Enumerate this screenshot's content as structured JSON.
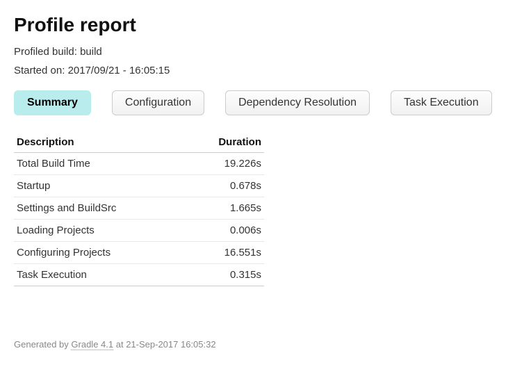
{
  "title": "Profile report",
  "profiled_build_label": "Profiled build:",
  "profiled_build_value": "build",
  "started_on_label": "Started on:",
  "started_on_value": "2017/09/21 - 16:05:15",
  "tabs": [
    {
      "label": "Summary",
      "active": true
    },
    {
      "label": "Configuration",
      "active": false
    },
    {
      "label": "Dependency Resolution",
      "active": false
    },
    {
      "label": "Task Execution",
      "active": false
    }
  ],
  "table": {
    "headers": {
      "description": "Description",
      "duration": "Duration"
    },
    "rows": [
      {
        "description": "Total Build Time",
        "duration": "19.226s"
      },
      {
        "description": "Startup",
        "duration": "0.678s"
      },
      {
        "description": "Settings and BuildSrc",
        "duration": "1.665s"
      },
      {
        "description": "Loading Projects",
        "duration": "0.006s"
      },
      {
        "description": "Configuring Projects",
        "duration": "16.551s"
      },
      {
        "description": "Task Execution",
        "duration": "0.315s"
      }
    ]
  },
  "footer": {
    "generated_by": "Generated by",
    "gradle_link": "Gradle 4.1",
    "at_label": "at",
    "timestamp": "21-Sep-2017 16:05:32"
  }
}
